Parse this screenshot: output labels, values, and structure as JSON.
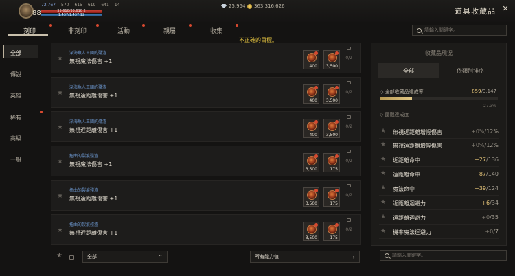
{
  "hud": {
    "level": "88",
    "stats": [
      "72,767",
      "570",
      "615",
      "619",
      "641",
      "14"
    ],
    "hp_text": "33,610/33,610 2",
    "mp_text": "1,437/1,437 12",
    "hp_fill": 1.0,
    "mp_fill": 1.0,
    "diamond": "25,954",
    "gold": "363,316,626"
  },
  "page_title": "道具收藏品",
  "close_icon": "close-icon",
  "tabs": [
    "刻印",
    "非刻印",
    "活動",
    "親屬",
    "收集"
  ],
  "active_tab": 0,
  "warning": "不正確的目標。",
  "search_placeholder": "請輸入關鍵字。",
  "categories": [
    "全部",
    "傳說",
    "英雄",
    "稀有",
    "高級",
    "一般"
  ],
  "active_category": 0,
  "list": [
    {
      "sub": "深海魚人王國的殘渣",
      "name": "無視魔法傷害 +1",
      "slots": [
        {
          "q": "400"
        },
        {
          "q": "3,500"
        }
      ],
      "count": "0/2"
    },
    {
      "sub": "深海魚人王國的殘渣",
      "name": "無視遠距離傷害 +1",
      "slots": [
        {
          "q": "400"
        },
        {
          "q": "3,500"
        }
      ],
      "count": "0/2"
    },
    {
      "sub": "深海魚人王國的殘渣",
      "name": "無視近距離傷害 +1",
      "slots": [
        {
          "q": "400"
        },
        {
          "q": "3,500"
        }
      ],
      "count": "0/2"
    },
    {
      "sub": "扭曲的裂痕殘渣",
      "name": "無視魔法傷害 +1",
      "slots": [
        {
          "q": "3,500"
        },
        {
          "q": "175"
        }
      ],
      "count": "0/2"
    },
    {
      "sub": "扭曲的裂痕殘渣",
      "name": "無視遠距離傷害 +1",
      "slots": [
        {
          "q": "3,500"
        },
        {
          "q": "175"
        }
      ],
      "count": "0/2"
    },
    {
      "sub": "扭曲的裂痕殘渣",
      "name": "無視近距離傷害 +1",
      "slots": [
        {
          "q": "3,500"
        },
        {
          "q": "175"
        }
      ],
      "count": "0/2"
    }
  ],
  "filters": {
    "grade": "全部",
    "ability": "所有能力值"
  },
  "panel": {
    "title": "收藏品現況",
    "tab_all": "全部",
    "tab_sort": "依類別排序",
    "progress_label": "全部收藏品達成率",
    "progress_done": "859",
    "progress_total": "/3,147",
    "progress_fraction": 0.273,
    "progress_pct": "27.3%",
    "level_label": "圍觀達成度",
    "stats": [
      {
        "name": "無視近距離增幅傷害",
        "plus": "+0%",
        "total": "/12%"
      },
      {
        "name": "無視遠距離增幅傷害",
        "plus": "+0%",
        "total": "/12%"
      },
      {
        "name": "近距離命中",
        "plus": "+27",
        "total": "/136"
      },
      {
        "name": "遠距離命中",
        "plus": "+87",
        "total": "/140"
      },
      {
        "name": "魔法命中",
        "plus": "+39",
        "total": "/124"
      },
      {
        "name": "近距離迴避力",
        "plus": "+6",
        "total": "/34"
      },
      {
        "name": "遠距離迴避力",
        "plus": "+0",
        "total": "/35"
      },
      {
        "name": "機率魔法迴避力",
        "plus": "+0",
        "total": "/7"
      }
    ]
  }
}
